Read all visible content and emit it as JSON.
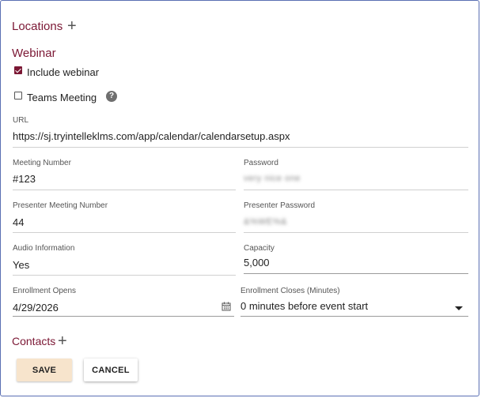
{
  "locations": {
    "title": "Locations",
    "add_icon": "plus-icon"
  },
  "webinar": {
    "title": "Webinar",
    "include_webinar": {
      "label": "Include webinar",
      "checked": true
    },
    "teams_meeting": {
      "label": "Teams Meeting",
      "checked": false,
      "help_icon": "question-circle-icon"
    }
  },
  "fields": {
    "url": {
      "label": "URL",
      "value": "https://sj.tryintelleklms.com/app/calendar/calendarsetup.aspx"
    },
    "meeting_number": {
      "label": "Meeting Number",
      "value": "#123"
    },
    "password": {
      "label": "Password",
      "value": "very nice one"
    },
    "presenter_meeting_number": {
      "label": "Presenter Meeting Number",
      "value": "44"
    },
    "presenter_password": {
      "label": "Presenter Password",
      "value": "&%WE%&"
    },
    "audio_information": {
      "label": "Audio Information",
      "value": "Yes"
    },
    "capacity": {
      "label": "Capacity",
      "value": "5,000"
    },
    "enrollment_opens": {
      "label": "Enrollment Opens",
      "value": "4/29/2026",
      "icon": "calendar-icon"
    },
    "enrollment_closes": {
      "label": "Enrollment Closes (Minutes)",
      "value": "0 minutes before event start",
      "icon": "caret-down-icon"
    }
  },
  "contacts": {
    "title": "Contacts",
    "add_icon": "plus-icon"
  },
  "buttons": {
    "save": "SAVE",
    "cancel": "CANCEL"
  },
  "colors": {
    "accent": "#7b1734",
    "save_bg": "#f7e4cc",
    "border": "#5a6fb3"
  }
}
